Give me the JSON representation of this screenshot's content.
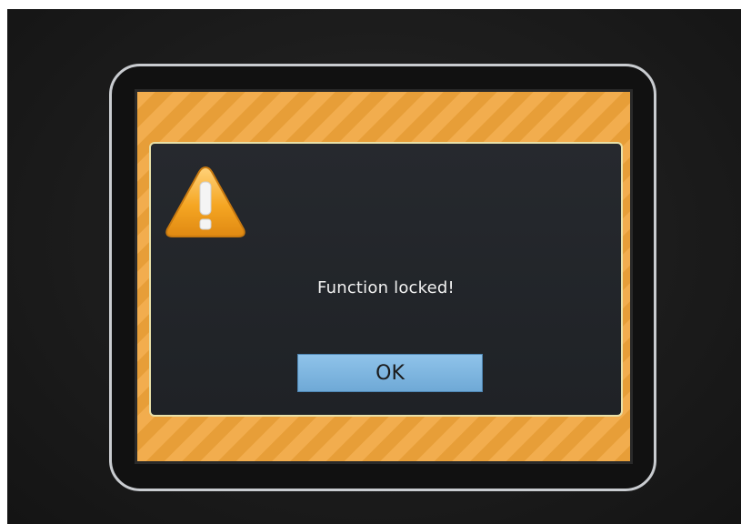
{
  "dialog": {
    "icon": "warning-icon",
    "message": "Function locked!",
    "ok_label": "OK"
  },
  "colors": {
    "screen_background": "#f0a43a",
    "dialog_background": "#24272b",
    "dialog_border": "#e8e0a8",
    "button_background": "#7fb6e0",
    "warning_fill": "#f5a623",
    "bezel_ring": "#c9ccd0"
  }
}
